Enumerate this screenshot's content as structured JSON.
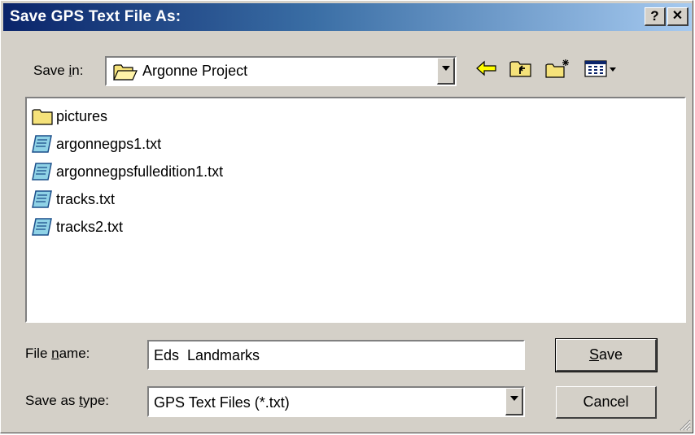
{
  "window": {
    "title": "Save GPS Text File As:",
    "help_label": "?",
    "close_label": "✕"
  },
  "save_in": {
    "label_pre": "Save ",
    "label_mnemonic": "i",
    "label_post": "n:",
    "value": "Argonne Project"
  },
  "toolbar": {
    "icons": [
      "back-arrow-icon",
      "up-one-level-icon",
      "new-folder-icon",
      "view-menu-icon"
    ]
  },
  "files": [
    {
      "name": "pictures",
      "type": "folder"
    },
    {
      "name": "argonnegps1.txt",
      "type": "text-file"
    },
    {
      "name": "argonnegpsfulledition1.txt",
      "type": "text-file"
    },
    {
      "name": "tracks.txt",
      "type": "text-file"
    },
    {
      "name": "tracks2.txt",
      "type": "text-file"
    }
  ],
  "file_name": {
    "label_pre": "File ",
    "label_mnemonic": "n",
    "label_post": "ame:",
    "value": "Eds  Landmarks"
  },
  "save_as_type": {
    "label_pre": "Save as ",
    "label_mnemonic": "t",
    "label_post": "ype:",
    "value": "GPS Text Files (*.txt)"
  },
  "buttons": {
    "save_mnemonic": "S",
    "save_rest": "ave",
    "cancel": "Cancel"
  },
  "colors": {
    "titlebar_start": "#0a246a",
    "titlebar_end": "#a6caf0",
    "face": "#d4d0c8"
  }
}
